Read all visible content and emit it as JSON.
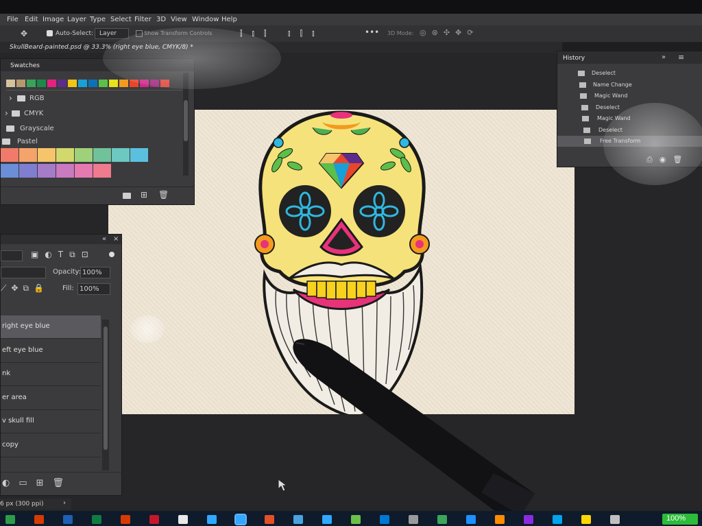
{
  "menu": {
    "items": [
      "File",
      "Edit",
      "Image",
      "Layer",
      "Type",
      "Select",
      "Filter",
      "3D",
      "View",
      "Window",
      "Help"
    ]
  },
  "options_bar": {
    "auto_select_label": "Auto-Select:",
    "layer_select_value": "Layer",
    "show_transform_controls": "Show Transform Controls",
    "mode_3d": "3D Mode:"
  },
  "document_tab": {
    "title": "SkullBeard-painted.psd @ 33.3% (right eye blue, CMYK/8) *"
  },
  "swatches_panel": {
    "title": "Swatches",
    "groups": [
      {
        "label": "RGB"
      },
      {
        "label": "CMYK"
      },
      {
        "label": "Grayscale"
      },
      {
        "label": "Pastel"
      }
    ],
    "top_colors": [
      "#d7c39b",
      "#b69a6e",
      "#3aa35a",
      "#1c8a4a",
      "#e6217f",
      "#5e2b8c",
      "#f0c419",
      "#18a0d8",
      "#0b72b8",
      "#5bbf4a",
      "#e8e21a",
      "#f39a1e",
      "#e8462a",
      "#cf2a8a",
      "#a02a7e",
      "#e0443a"
    ],
    "pastel_row1": [
      "#f17a6a",
      "#f4a46a",
      "#f6c46a",
      "#d2d86c",
      "#9fd07a",
      "#6fc29a",
      "#6cc8c0",
      "#5bc0e0"
    ],
    "pastel_row2": [
      "#6a8fd8",
      "#7f7ed0",
      "#a47cc8",
      "#c97ac0",
      "#e57ab0",
      "#f07a8e"
    ]
  },
  "history_panel": {
    "title": "History",
    "items": [
      "Deselect",
      "Name Change",
      "Magic Wand",
      "Deselect",
      "Magic Wand",
      "Deselect",
      "Free Transform"
    ]
  },
  "layers_panel": {
    "opacity_label": "Opacity:",
    "opacity_value": "100%",
    "fill_label": "Fill:",
    "fill_value": "100%",
    "layers": [
      "right eye blue",
      "eft eye blue",
      "nk",
      "er area",
      "v skull fill",
      "copy"
    ]
  },
  "status_bar": {
    "text": "6 px (300 ppi)"
  },
  "taskbar": {
    "battery": "100%"
  },
  "colors": {
    "canvas_bg": "#efe6d6",
    "skull_fill": "#f6e27a",
    "eye_blue": "#2fb8e0",
    "teeth_pink": "#e8327a"
  }
}
